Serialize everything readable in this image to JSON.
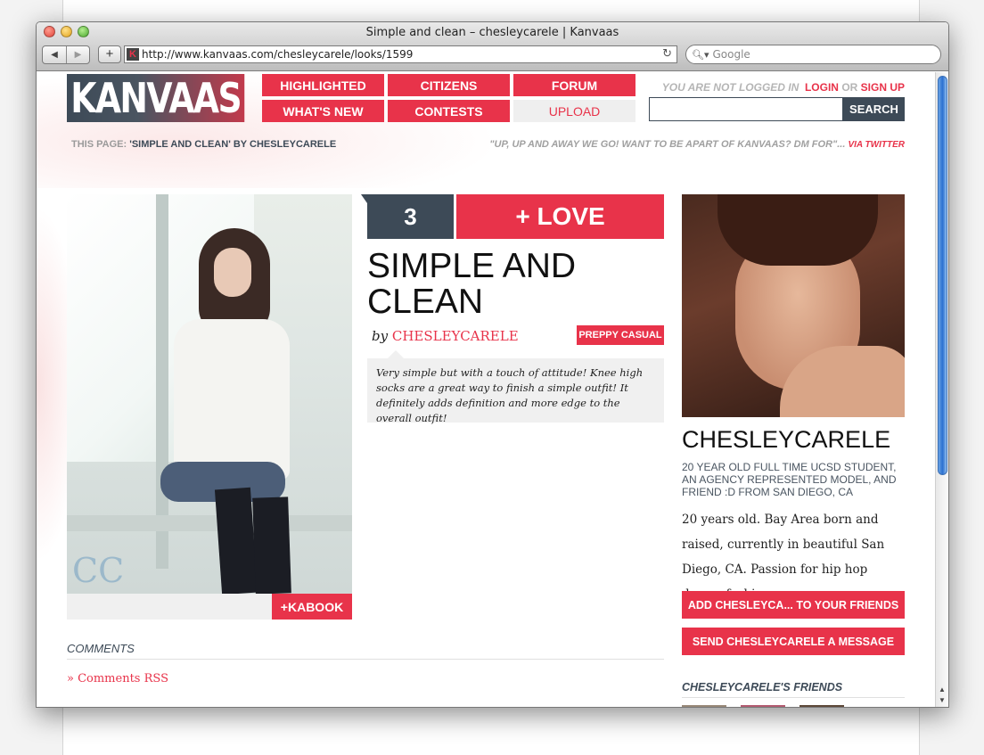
{
  "browser": {
    "window_title": "Simple and clean – chesleycarele | Kanvaas",
    "url": "http://www.kanvaas.com/chesleycarele/looks/1599",
    "search_placeholder": "Google",
    "favicon_letter": "K"
  },
  "site": {
    "logo": "KANVAAS",
    "nav": {
      "highlighted": "HIGHLIGHTED",
      "citizens": "CITIZENS",
      "forum": "FORUM",
      "whats_new": "WHAT'S NEW",
      "contests": "CONTESTS",
      "upload": "UPLOAD"
    },
    "login": {
      "status": "YOU ARE NOT LOGGED IN",
      "login_label": "LOGIN",
      "or": "OR",
      "signup_label": "SIGN UP"
    },
    "search_button": "SEARCH",
    "this_page_label": "THIS PAGE:",
    "this_page_value": "'SIMPLE AND CLEAN' BY CHESLEYCARELE",
    "tweet_text": "\"UP, UP AND AWAY WE GO! WANT TO BE APART OF KANVAAS? DM FOR\"...",
    "tweet_via": "VIA TWITTER",
    "accent_color": "#e8334a",
    "dark_color": "#3d4a57"
  },
  "look": {
    "love_count": "3",
    "love_button": "+ LOVE",
    "title": "SIMPLE AND CLEAN",
    "by_label": "by",
    "author": "CHESLEYCARELE",
    "tag": "PREPPY CASUAL",
    "description": "Very simple but with a touch of attitude! Knee high socks are a great way to finish a simple outfit! It definitely adds definition and more edge to the overall outfit!",
    "kabook_button": "+KABOOK",
    "watermark": "CC"
  },
  "comments": {
    "heading": "COMMENTS",
    "rss_link": "» Comments RSS"
  },
  "profile": {
    "name": "CHESLEYCARELE",
    "tagline": "20 YEAR OLD FULL TIME UCSD STUDENT, AN AGENCY REPRESENTED MODEL, AND FRIEND :D FROM SAN DIEGO, CA",
    "bio": "20 years old. Bay Area born and raised, currently in beautiful San Diego, CA. Passion for hip hop dance, fashion",
    "bio_more": "...",
    "add_friend_button": "ADD CHESLEYCA... TO YOUR FRIENDS",
    "message_button": "SEND CHESLEYCARELE A MESSAGE",
    "friends_heading": "CHESLEYCARELE'S FRIENDS"
  }
}
